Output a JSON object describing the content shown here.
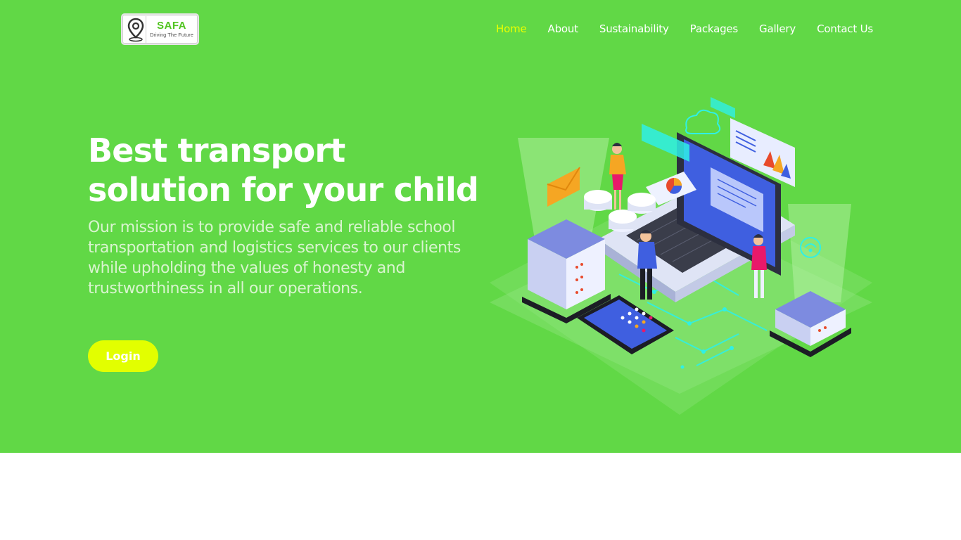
{
  "logo": {
    "name": "SAFA",
    "tagline": "Driving The Future"
  },
  "nav": {
    "items": [
      {
        "label": "Home",
        "active": true
      },
      {
        "label": "About"
      },
      {
        "label": "Sustainability"
      },
      {
        "label": "Packages"
      },
      {
        "label": "Gallery"
      },
      {
        "label": "Contact Us"
      }
    ]
  },
  "hero": {
    "headline": "Best transport solution for your child",
    "mission": "Our mission is to provide safe and reliable school transportation and logistics services to our clients while upholding the values of honesty and trustworthiness in all our operations.",
    "login_label": "Login"
  },
  "colors": {
    "hero_bg": "#61d846",
    "accent": "#e2ff00",
    "active_nav": "#eaff00",
    "brand_green": "#50c41f"
  },
  "illustration": {
    "icon": "isometric-technology-illustration"
  }
}
